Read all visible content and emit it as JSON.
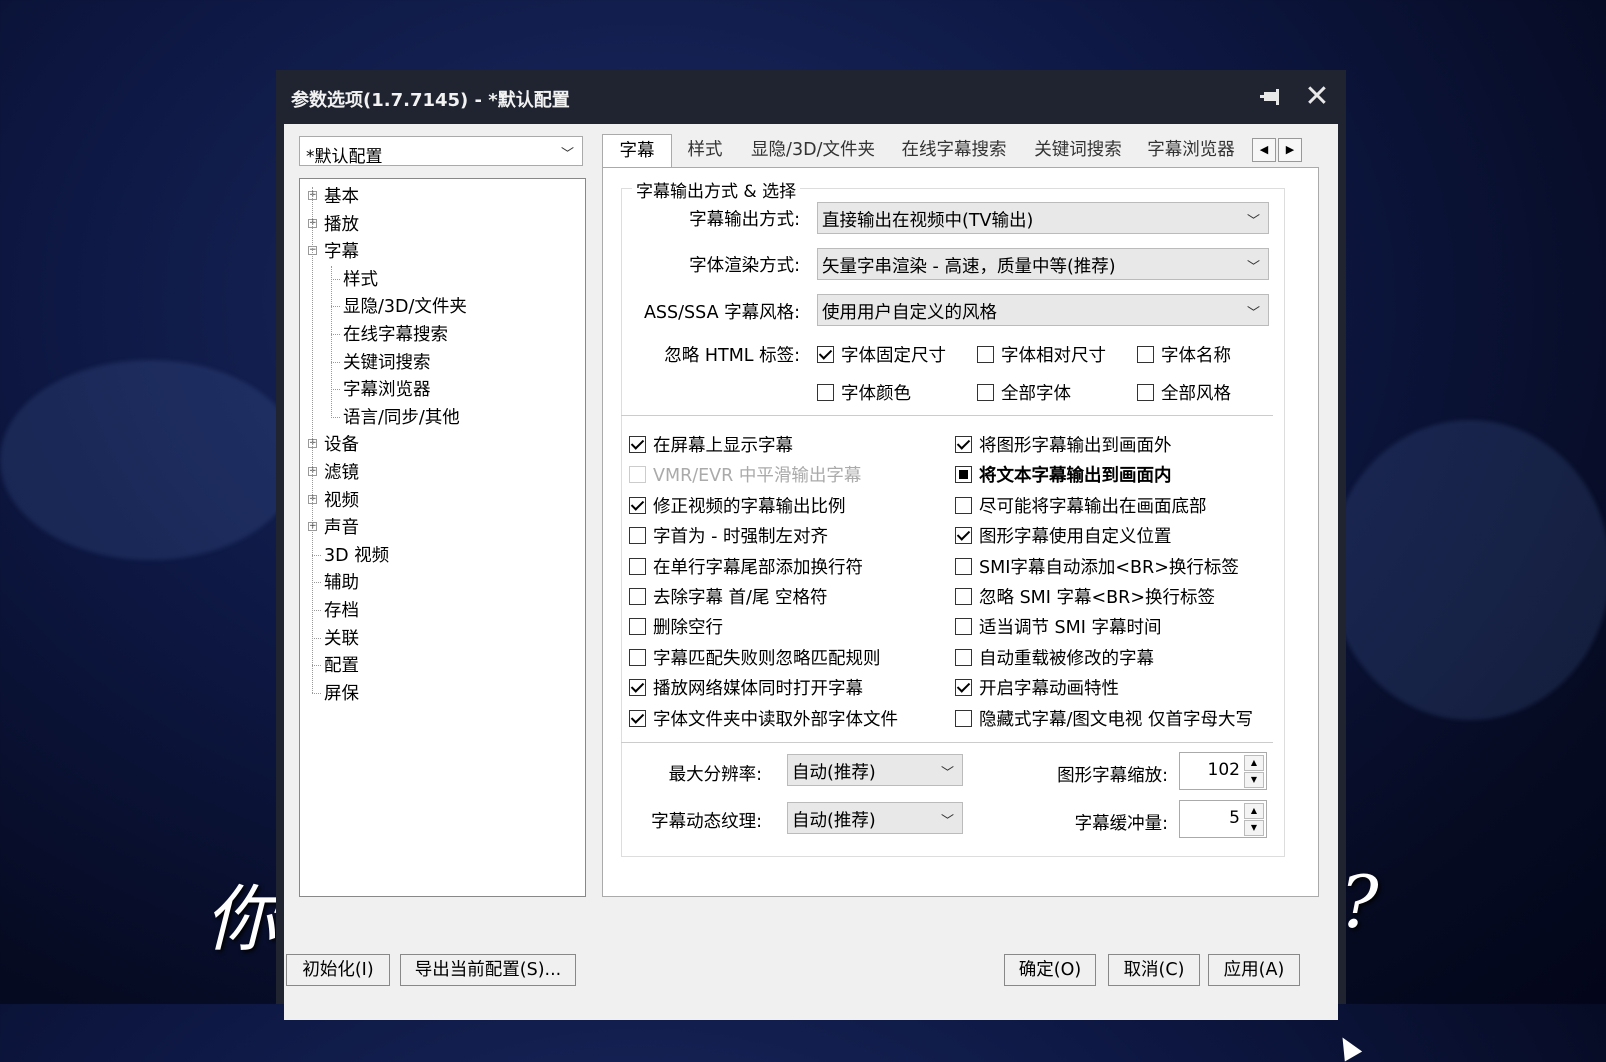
{
  "background": {
    "left_glyph": "你",
    "right_glyph": "?"
  },
  "window": {
    "title": "参数选项(1.7.7145) - *默认配置"
  },
  "profile": {
    "selected": "*默认配置"
  },
  "tree": [
    {
      "label": "基本",
      "expander": "+"
    },
    {
      "label": "播放",
      "expander": "+"
    },
    {
      "label": "字幕",
      "expander": "-"
    },
    {
      "label": "样式"
    },
    {
      "label": "显隐/3D/文件夹"
    },
    {
      "label": "在线字幕搜索"
    },
    {
      "label": "关键词搜索"
    },
    {
      "label": "字幕浏览器"
    },
    {
      "label": "语言/同步/其他"
    },
    {
      "label": "设备",
      "expander": "+"
    },
    {
      "label": "滤镜",
      "expander": "+"
    },
    {
      "label": "视频",
      "expander": "+"
    },
    {
      "label": "声音",
      "expander": "+"
    },
    {
      "label": "3D 视频"
    },
    {
      "label": "辅助"
    },
    {
      "label": "存档"
    },
    {
      "label": "关联"
    },
    {
      "label": "配置"
    },
    {
      "label": "屏保"
    }
  ],
  "tabs": [
    "字幕",
    "样式",
    "显隐/3D/文件夹",
    "在线字幕搜索",
    "关键词搜索",
    "字幕浏览器"
  ],
  "tab_scroll": {
    "left": "◀",
    "right": "▶"
  },
  "group": {
    "title": "字幕输出方式 & 选择",
    "output_mode_label": "字幕输出方式:",
    "output_mode_value": "直接输出在视频中(TV输出)",
    "render_label": "字体渲染方式:",
    "render_value": "矢量字串渲染 - 高速，质量中等(推荐)",
    "ass_label": "ASS/SSA 字幕风格:",
    "ass_value": "使用用户自定义的风格",
    "ignore_html_label": "忽略 HTML 标签:",
    "html_options": [
      {
        "label": "字体固定尺寸",
        "checked": true
      },
      {
        "label": "字体相对尺寸",
        "checked": false
      },
      {
        "label": "字体名称",
        "checked": false
      },
      {
        "label": "字体颜色",
        "checked": false
      },
      {
        "label": "全部字体",
        "checked": false
      },
      {
        "label": "全部风格",
        "checked": false
      }
    ]
  },
  "options_left": [
    {
      "label": "在屏幕上显示字幕",
      "state": "checked"
    },
    {
      "label": "VMR/EVR 中平滑输出字幕",
      "state": "disabled"
    },
    {
      "label": "修正视频的字幕输出比例",
      "state": "checked"
    },
    {
      "label": "字首为 - 时强制左对齐",
      "state": "unchecked"
    },
    {
      "label": "在单行字幕尾部添加换行符",
      "state": "unchecked"
    },
    {
      "label": "去除字幕 首/尾 空格符",
      "state": "unchecked"
    },
    {
      "label": "删除空行",
      "state": "unchecked"
    },
    {
      "label": "字幕匹配失败则忽略匹配规则",
      "state": "unchecked"
    },
    {
      "label": "播放网络媒体同时打开字幕",
      "state": "checked"
    },
    {
      "label": "字体文件夹中读取外部字体文件",
      "state": "checked"
    }
  ],
  "options_right": [
    {
      "label": "将图形字幕输出到画面外",
      "state": "checked"
    },
    {
      "label": "将文本字幕输出到画面内",
      "state": "indeterminate"
    },
    {
      "label": "尽可能将字幕输出在画面底部",
      "state": "unchecked"
    },
    {
      "label": "图形字幕使用自定义位置",
      "state": "checked"
    },
    {
      "label": "SMI字幕自动添加<BR>换行标签",
      "state": "unchecked"
    },
    {
      "label": "忽略 SMI 字幕<BR>换行标签",
      "state": "unchecked"
    },
    {
      "label": "适当调节 SMI 字幕时间",
      "state": "unchecked"
    },
    {
      "label": "自动重载被修改的字幕",
      "state": "unchecked"
    },
    {
      "label": "开启字幕动画特性",
      "state": "checked"
    },
    {
      "label": "隐藏式字幕/图文电视 仅首字母大写",
      "state": "unchecked"
    }
  ],
  "bottom": {
    "max_res_label": "最大分辨率:",
    "max_res_value": "自动(推荐)",
    "texture_label": "字幕动态纹理:",
    "texture_value": "自动(推荐)",
    "scale_label": "图形字幕缩放:",
    "scale_value": "102",
    "buffer_label": "字幕缓冲量:",
    "buffer_value": "5"
  },
  "buttons": {
    "reset": "初始化(I)",
    "export": "导出当前配置(S)...",
    "ok": "确定(O)",
    "cancel": "取消(C)",
    "apply": "应用(A)"
  },
  "colors": {
    "titlebar": "#1f2430",
    "dialog_bg": "#f0f0f0"
  }
}
